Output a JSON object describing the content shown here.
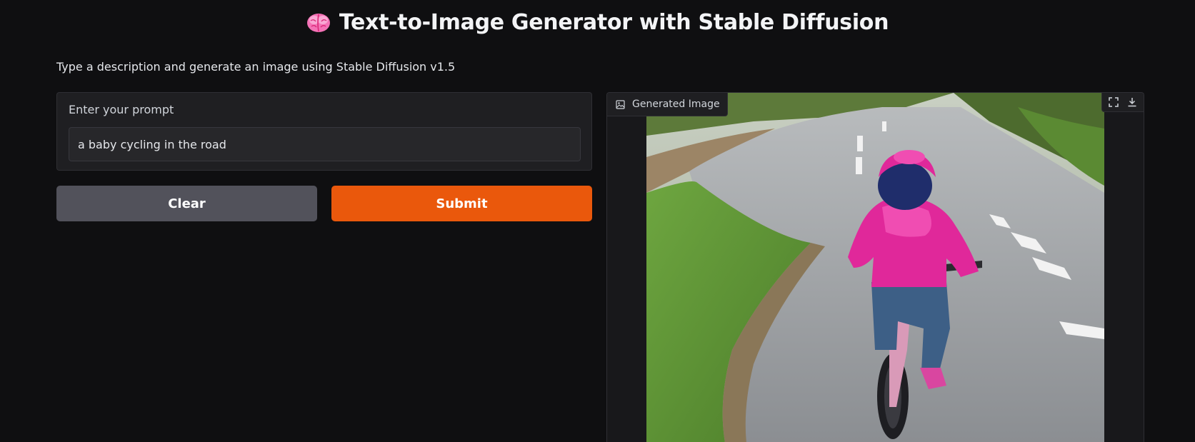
{
  "header": {
    "title": "Text-to-Image Generator with Stable Diffusion",
    "icon": "brain-icon",
    "subtitle": "Type a description and generate an image using Stable Diffusion v1.5"
  },
  "input": {
    "label": "Enter your prompt",
    "value": "a baby cycling in the road"
  },
  "buttons": {
    "clear_label": "Clear",
    "submit_label": "Submit"
  },
  "output": {
    "label": "Generated Image",
    "label_icon": "image-icon",
    "toolbar_icons": [
      "fullscreen-icon",
      "download-icon"
    ]
  },
  "colors": {
    "background": "#0f0f11",
    "panel": "#1f1f22",
    "submit": "#ea580c",
    "clear": "#52525b"
  }
}
